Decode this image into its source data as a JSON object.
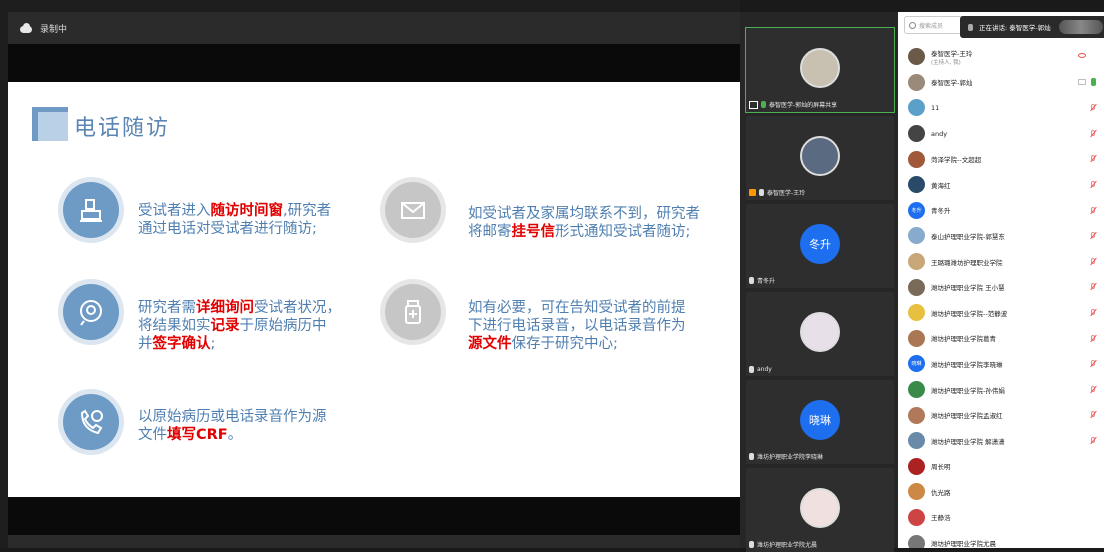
{
  "recording": {
    "label": "录制中"
  },
  "slide": {
    "title": "电话随访",
    "items": [
      {
        "icon": "patient-bed-icon",
        "style": "blue",
        "lines": [
          [
            {
              "t": "受试者进入",
              "hl": false
            },
            {
              "t": "随访时间窗",
              "hl": true
            },
            {
              "t": ",研究者",
              "hl": false
            }
          ],
          [
            {
              "t": "通过电话对受试者进行随访;",
              "hl": false
            }
          ]
        ]
      },
      {
        "icon": "mail-envelope-icon",
        "style": "grey",
        "lines": [
          [
            {
              "t": "如受试者及家属均联系不到，研究者",
              "hl": false
            }
          ],
          [
            {
              "t": "将邮寄",
              "hl": false
            },
            {
              "t": "挂号信",
              "hl": true
            },
            {
              "t": "形式通知受试者随访;",
              "hl": false
            }
          ]
        ]
      },
      {
        "icon": "consult-chat-icon",
        "style": "blue",
        "lines": [
          [
            {
              "t": "研究者需",
              "hl": false
            },
            {
              "t": "详细询问",
              "hl": true
            },
            {
              "t": "受试者状况，",
              "hl": false
            }
          ],
          [
            {
              "t": "将结果如实",
              "hl": false
            },
            {
              "t": "记录",
              "hl": true
            },
            {
              "t": "于原始病历中",
              "hl": false
            }
          ],
          [
            {
              "t": "并",
              "hl": false
            },
            {
              "t": "签字确认",
              "hl": true
            },
            {
              "t": ";",
              "hl": false
            }
          ]
        ]
      },
      {
        "icon": "medicine-bottle-icon",
        "style": "grey",
        "lines": [
          [
            {
              "t": "如有必要，可在告知受试者的前提",
              "hl": false
            }
          ],
          [
            {
              "t": "下进行电话录音，以电话录音作为",
              "hl": false
            }
          ],
          [
            {
              "t": "源文件",
              "hl": true
            },
            {
              "t": "保存于研究中心;",
              "hl": false
            }
          ]
        ]
      },
      {
        "icon": "phone-medical-icon",
        "style": "blue",
        "lines": [
          [
            {
              "t": "以原始病历或电话录音作为源",
              "hl": false
            }
          ],
          [
            {
              "t": "文件",
              "hl": false
            },
            {
              "t": "填写CRF",
              "hl": true
            },
            {
              "t": "。",
              "hl": false
            }
          ]
        ]
      }
    ]
  },
  "tiles": [
    {
      "name": "泰智医学-郭灿的屏幕共享",
      "avatar": "photo-avatar",
      "avatar_text": "",
      "active": true,
      "mic": "on",
      "screen": true,
      "host": false
    },
    {
      "name": "泰智医学-王玲",
      "avatar": "photo-avatar",
      "avatar_text": "",
      "active": false,
      "mic": "off",
      "screen": false,
      "host": true
    },
    {
      "name": "青冬升",
      "avatar": "text-avatar",
      "avatar_text": "冬升",
      "active": false,
      "mic": "off",
      "screen": false,
      "host": false
    },
    {
      "name": "andy",
      "avatar": "photo-avatar",
      "avatar_text": "",
      "active": false,
      "mic": "off",
      "screen": false,
      "host": false
    },
    {
      "name": "潍坊护理职业学院李晓琳",
      "avatar": "text-avatar",
      "avatar_text": "晓琳",
      "active": false,
      "mic": "off",
      "screen": false,
      "host": false
    },
    {
      "name": "潍坊护理职业学院尤晨",
      "avatar": "photo-avatar",
      "avatar_text": "",
      "active": false,
      "mic": "off",
      "screen": false,
      "host": false
    }
  ],
  "members_panel": {
    "search_placeholder": "搜索成员",
    "speaking": "正在讲话: 泰智医学-郭灿",
    "members": [
      {
        "name": "泰智医学-王玲",
        "sub": "(主持人, 我)",
        "avatar_text": "",
        "color": "#6b5a48",
        "status": "eye"
      },
      {
        "name": "泰智医学-郭灿",
        "sub": "",
        "avatar_text": "",
        "color": "#9a8a7a",
        "status": "speaking"
      },
      {
        "name": "11",
        "sub": "",
        "avatar_text": "",
        "color": "#5aa0c8",
        "status": "muted"
      },
      {
        "name": "andy",
        "sub": "",
        "avatar_text": "",
        "color": "#444",
        "status": "muted"
      },
      {
        "name": "菏泽学院--文超超",
        "sub": "",
        "avatar_text": "",
        "color": "#a05a3a",
        "status": "muted"
      },
      {
        "name": "黄海红",
        "sub": "",
        "avatar_text": "",
        "color": "#2a4a6a",
        "status": "muted"
      },
      {
        "name": "青冬升",
        "sub": "",
        "avatar_text": "冬升",
        "color": "#1e6ff0",
        "status": "muted"
      },
      {
        "name": "泰山护理职业学院-郭慧东",
        "sub": "",
        "avatar_text": "",
        "color": "#88aacc",
        "status": "muted"
      },
      {
        "name": "王璐璐潍坊护理职业学院",
        "sub": "",
        "avatar_text": "",
        "color": "#c8a878",
        "status": "muted"
      },
      {
        "name": "潍坊护理职业学院 王小慧",
        "sub": "",
        "avatar_text": "",
        "color": "#7a6a5a",
        "status": "muted"
      },
      {
        "name": "潍坊护理职业学院--范静波",
        "sub": "",
        "avatar_text": "",
        "color": "#e8c040",
        "status": "muted"
      },
      {
        "name": "潍坊护理职业学院葛青",
        "sub": "",
        "avatar_text": "",
        "color": "#aa7755",
        "status": "muted"
      },
      {
        "name": "潍坊护理职业学院李晓琳",
        "sub": "",
        "avatar_text": "晓琳",
        "color": "#1e6ff0",
        "status": "muted"
      },
      {
        "name": "潍坊护理职业学院-孙伟娟",
        "sub": "",
        "avatar_text": "",
        "color": "#3a8a4a",
        "status": "muted"
      },
      {
        "name": "潍坊护理职业学院孟淑红",
        "sub": "",
        "avatar_text": "",
        "color": "#b07a5a",
        "status": "muted"
      },
      {
        "name": "潍坊护理职业学院 解潇潇",
        "sub": "",
        "avatar_text": "",
        "color": "#6a8aaa",
        "status": "muted"
      },
      {
        "name": "周长明",
        "sub": "",
        "avatar_text": "",
        "color": "#aa2222",
        "status": "none"
      },
      {
        "name": "仇光路",
        "sub": "",
        "avatar_text": "",
        "color": "#cc8844",
        "status": "none"
      },
      {
        "name": "王静浩",
        "sub": "",
        "avatar_text": "",
        "color": "#c44",
        "status": "none"
      },
      {
        "name": "潍坊护理职业学院尤晨",
        "sub": "",
        "avatar_text": "",
        "color": "#777",
        "status": "none"
      }
    ]
  }
}
